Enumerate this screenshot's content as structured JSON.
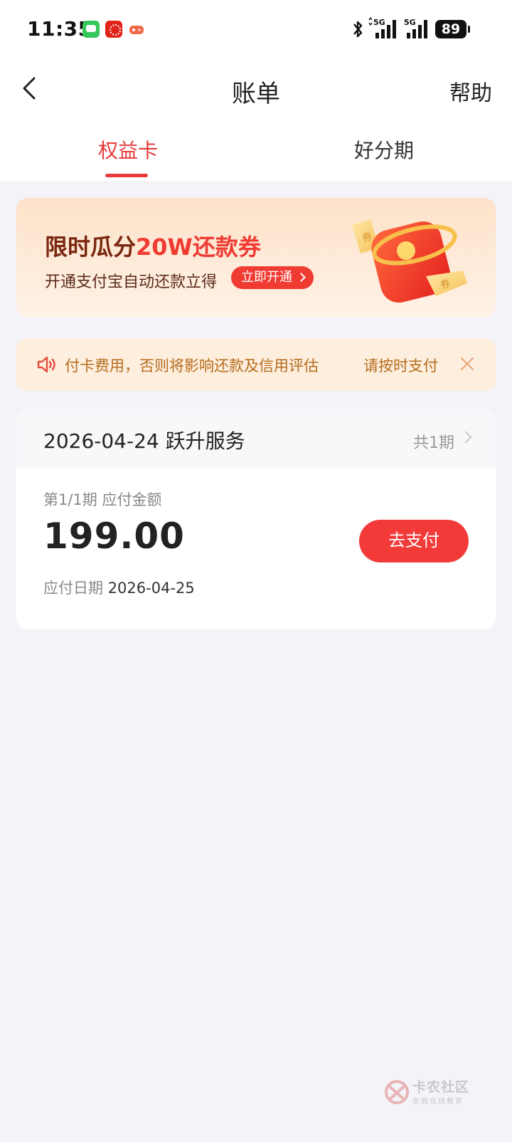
{
  "status_bar": {
    "time": "11:35",
    "battery": "89",
    "network_1": "5G",
    "network_2": "5G"
  },
  "nav": {
    "title": "账单",
    "help": "帮助"
  },
  "tabs": [
    {
      "label": "权益卡",
      "active": true
    },
    {
      "label": "好分期",
      "active": false
    }
  ],
  "promo": {
    "title_prefix": "限时瓜分",
    "title_highlight": "20W还款券",
    "subtitle": "开通支付宝自动还款立得",
    "cta": "立即开通",
    "coupon_glyph": "券"
  },
  "notice": {
    "text": "付卡费用，否则将影响还款及信用评估　　　请按时支付"
  },
  "bill": {
    "title": "2026-04-24 跃升服务",
    "periods": "共1期",
    "period_label": "第1/1期 应付金额",
    "amount": "199.00",
    "due_label": "应付日期",
    "due_date": "2026-04-25",
    "pay_button": "去支付"
  },
  "watermark": {
    "title": "卡农社区",
    "subtitle": "金融在线教育"
  },
  "colors": {
    "accent": "#e73a3a",
    "pay_button": "#f23a39",
    "background": "#f3f3f8",
    "notice_bg": "#fdeedd",
    "notice_text": "#b56c1e"
  }
}
